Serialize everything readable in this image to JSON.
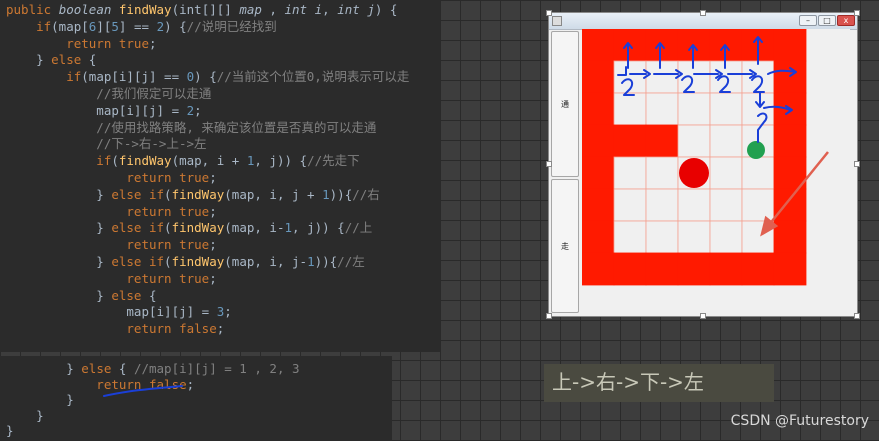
{
  "code_top": [
    {
      "segs": [
        {
          "t": "public ",
          "c": "kw"
        },
        {
          "t": "boolean ",
          "c": "kw it"
        },
        {
          "t": "findWay",
          "c": "fn"
        },
        {
          "t": "(int[][] "
        },
        {
          "t": "map",
          "c": "it"
        },
        {
          "t": " , "
        },
        {
          "t": "int ",
          "c": "kw it"
        },
        {
          "t": "i",
          "c": "it"
        },
        {
          "t": ", "
        },
        {
          "t": "int ",
          "c": "kw it"
        },
        {
          "t": "j",
          "c": "it"
        },
        {
          "t": ") {"
        }
      ]
    },
    {
      "segs": [
        {
          "t": "    if",
          "c": "kw"
        },
        {
          "t": "(map["
        },
        {
          "t": "6",
          "c": "num"
        },
        {
          "t": "]["
        },
        {
          "t": "5",
          "c": "num"
        },
        {
          "t": "] == "
        },
        {
          "t": "2",
          "c": "num"
        },
        {
          "t": ") {"
        },
        {
          "t": "//说明已经找到",
          "c": "cm"
        }
      ]
    },
    {
      "segs": [
        {
          "t": "        return true",
          "c": "kw"
        },
        {
          "t": ";"
        }
      ]
    },
    {
      "segs": [
        {
          "t": "    } "
        },
        {
          "t": "else",
          "c": "kw"
        },
        {
          "t": " {"
        }
      ]
    },
    {
      "segs": [
        {
          "t": "        if",
          "c": "kw"
        },
        {
          "t": "(map[i][j] == "
        },
        {
          "t": "0",
          "c": "num"
        },
        {
          "t": ") {"
        },
        {
          "t": "//当前这个位置0,说明表示可以走",
          "c": "cm"
        }
      ]
    },
    {
      "segs": [
        {
          "t": "            //我们假定可以走通",
          "c": "cm"
        }
      ]
    },
    {
      "segs": [
        {
          "t": "            map[i][j] = "
        },
        {
          "t": "2",
          "c": "num"
        },
        {
          "t": ";"
        }
      ]
    },
    {
      "segs": [
        {
          "t": "            //使用找路策略, 来确定该位置是否真的可以走通",
          "c": "cm"
        }
      ]
    },
    {
      "segs": [
        {
          "t": "            //下->右->上->左",
          "c": "cm"
        }
      ]
    },
    {
      "segs": [
        {
          "t": "            if",
          "c": "kw"
        },
        {
          "t": "("
        },
        {
          "t": "findWay",
          "c": "fn"
        },
        {
          "t": "(map, i + "
        },
        {
          "t": "1",
          "c": "num"
        },
        {
          "t": ", j)) {"
        },
        {
          "t": "//先走下",
          "c": "cm"
        }
      ]
    },
    {
      "segs": [
        {
          "t": "                return true",
          "c": "kw"
        },
        {
          "t": ";"
        }
      ]
    },
    {
      "segs": [
        {
          "t": "            } "
        },
        {
          "t": "else if",
          "c": "kw"
        },
        {
          "t": "("
        },
        {
          "t": "findWay",
          "c": "fn"
        },
        {
          "t": "(map, i, j + "
        },
        {
          "t": "1",
          "c": "num"
        },
        {
          "t": ")){"
        },
        {
          "t": "//右",
          "c": "cm"
        }
      ]
    },
    {
      "segs": [
        {
          "t": "                return true",
          "c": "kw"
        },
        {
          "t": ";"
        }
      ]
    },
    {
      "segs": [
        {
          "t": "            } "
        },
        {
          "t": "else if",
          "c": "kw"
        },
        {
          "t": "("
        },
        {
          "t": "findWay",
          "c": "fn"
        },
        {
          "t": "(map, i-"
        },
        {
          "t": "1",
          "c": "num"
        },
        {
          "t": ", j)) {"
        },
        {
          "t": "//上",
          "c": "cm"
        }
      ]
    },
    {
      "segs": [
        {
          "t": "                return true",
          "c": "kw"
        },
        {
          "t": ";"
        }
      ]
    },
    {
      "segs": [
        {
          "t": "            } "
        },
        {
          "t": "else if",
          "c": "kw"
        },
        {
          "t": "("
        },
        {
          "t": "findWay",
          "c": "fn"
        },
        {
          "t": "(map, i, j-"
        },
        {
          "t": "1",
          "c": "num"
        },
        {
          "t": ")){"
        },
        {
          "t": "//左",
          "c": "cm"
        }
      ]
    },
    {
      "segs": [
        {
          "t": "                return true",
          "c": "kw"
        },
        {
          "t": ";"
        }
      ]
    },
    {
      "segs": [
        {
          "t": "            } "
        },
        {
          "t": "else",
          "c": "kw"
        },
        {
          "t": " {"
        }
      ]
    },
    {
      "segs": [
        {
          "t": "                map[i][j] = "
        },
        {
          "t": "3",
          "c": "num"
        },
        {
          "t": ";"
        }
      ]
    },
    {
      "segs": [
        {
          "t": "                return false",
          "c": "kw"
        },
        {
          "t": ";"
        }
      ]
    }
  ],
  "code_bottom": [
    {
      "segs": [
        {
          "t": "        } "
        },
        {
          "t": "else",
          "c": "kw"
        },
        {
          "t": " { "
        },
        {
          "t": "//map[i][j] = 1 , 2, 3",
          "c": "cm"
        }
      ]
    },
    {
      "segs": [
        {
          "t": "            return false",
          "c": "kw"
        },
        {
          "t": ";"
        }
      ]
    },
    {
      "segs": [
        {
          "t": "        }"
        }
      ]
    },
    {
      "segs": [
        {
          "t": "    }"
        }
      ]
    },
    {
      "segs": [
        {
          "t": "}"
        }
      ]
    }
  ],
  "window": {
    "left_button_1": "通",
    "left_button_2": "走",
    "min_label": "–",
    "max_label": "□",
    "close_label": "x"
  },
  "maze": {
    "rows": 8,
    "cols": 7,
    "grid": [
      [
        1,
        1,
        1,
        1,
        1,
        1,
        1
      ],
      [
        1,
        0,
        0,
        0,
        0,
        0,
        1
      ],
      [
        1,
        0,
        0,
        0,
        0,
        0,
        1
      ],
      [
        1,
        1,
        1,
        0,
        0,
        0,
        1
      ],
      [
        1,
        0,
        0,
        0,
        0,
        0,
        1
      ],
      [
        1,
        0,
        0,
        0,
        0,
        0,
        1
      ],
      [
        1,
        0,
        0,
        0,
        0,
        0,
        1
      ],
      [
        1,
        1,
        1,
        1,
        1,
        1,
        1
      ]
    ],
    "wall_color": "#ff1a00",
    "open_color": "#f0f0f0",
    "ball": {
      "row": 4,
      "col": 3,
      "color": "#e80000"
    },
    "goal": {
      "row": 3,
      "col": 5,
      "color": "#22a050"
    }
  },
  "caption": "上->右->下->左",
  "watermark": "CSDN @Futurestory"
}
